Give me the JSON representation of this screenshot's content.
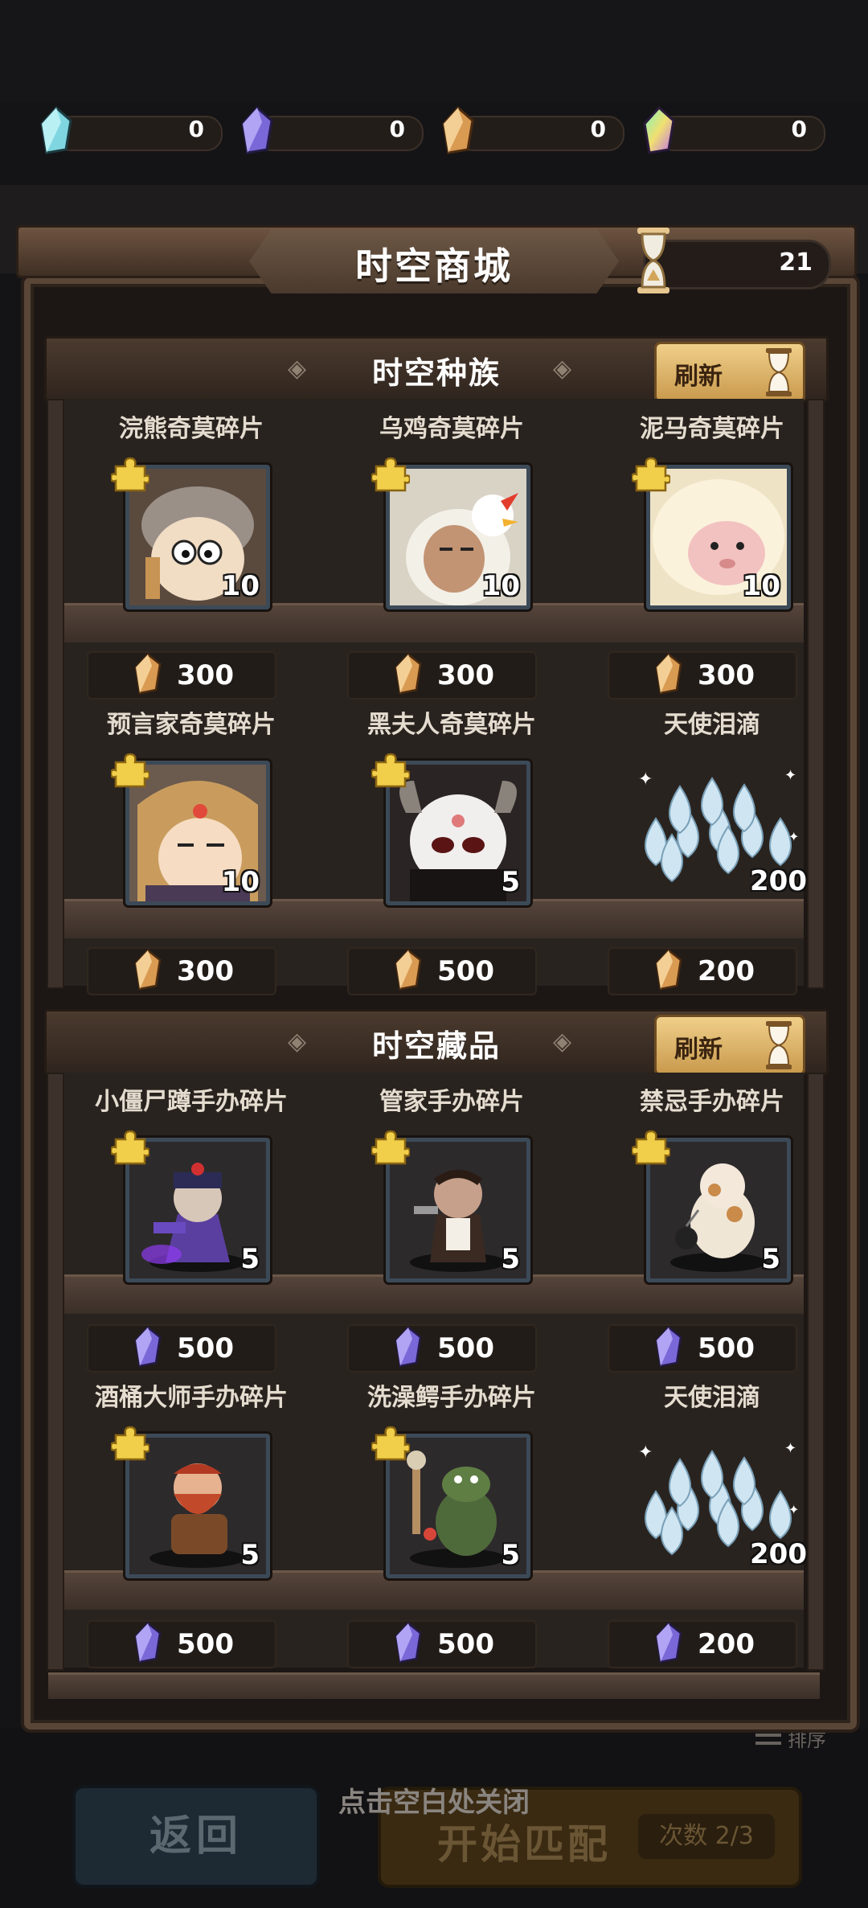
{
  "currency": [
    {
      "icon": "cyan-crystal-icon",
      "value": "0",
      "color": "#7fd6e0"
    },
    {
      "icon": "purple-crystal-icon",
      "value": "0",
      "color": "#8c7ae6"
    },
    {
      "icon": "gold-crystal-icon",
      "value": "0",
      "color": "#e0a860"
    },
    {
      "icon": "rainbow-crystal-icon",
      "value": "0",
      "color": "#c07ef0"
    }
  ],
  "shop": {
    "title": "时空商城",
    "hourglass_count": "21",
    "sections": [
      {
        "title": "时空种族",
        "refresh_label": "刷新",
        "items": [
          {
            "name": "浣熊奇莫碎片",
            "qty": "10",
            "price": "300",
            "currency": "gold",
            "art": "raccoon"
          },
          {
            "name": "乌鸡奇莫碎片",
            "qty": "10",
            "price": "300",
            "currency": "gold",
            "art": "chicken"
          },
          {
            "name": "泥马奇莫碎片",
            "qty": "10",
            "price": "300",
            "currency": "gold",
            "art": "alpaca"
          },
          {
            "name": "预言家奇莫碎片",
            "qty": "10",
            "price": "300",
            "currency": "gold",
            "art": "prophet"
          },
          {
            "name": "黑夫人奇莫碎片",
            "qty": "5",
            "price": "500",
            "currency": "gold",
            "art": "blacklady"
          },
          {
            "name": "天使泪滴",
            "qty": "200",
            "price": "200",
            "currency": "gold",
            "art": "tears"
          }
        ]
      },
      {
        "title": "时空藏品",
        "refresh_label": "刷新",
        "items": [
          {
            "name": "小僵尸蹲手办碎片",
            "qty": "5",
            "price": "500",
            "currency": "purple",
            "art": "zombie"
          },
          {
            "name": "管家手办碎片",
            "qty": "5",
            "price": "500",
            "currency": "purple",
            "art": "butler"
          },
          {
            "name": "禁忌手办碎片",
            "qty": "5",
            "price": "500",
            "currency": "purple",
            "art": "taboo"
          },
          {
            "name": "酒桶大师手办碎片",
            "qty": "5",
            "price": "500",
            "currency": "purple",
            "art": "brewer"
          },
          {
            "name": "洗澡鳄手办碎片",
            "qty": "5",
            "price": "500",
            "currency": "purple",
            "art": "croc"
          },
          {
            "name": "天使泪滴",
            "qty": "200",
            "price": "200",
            "currency": "purple",
            "art": "tears"
          }
        ]
      }
    ]
  },
  "footer": {
    "close_hint": "点击空白处关闭",
    "back_label": "返回",
    "match_label": "开始匹配",
    "count_label": "次数 2/3",
    "sort_label": "排序"
  }
}
